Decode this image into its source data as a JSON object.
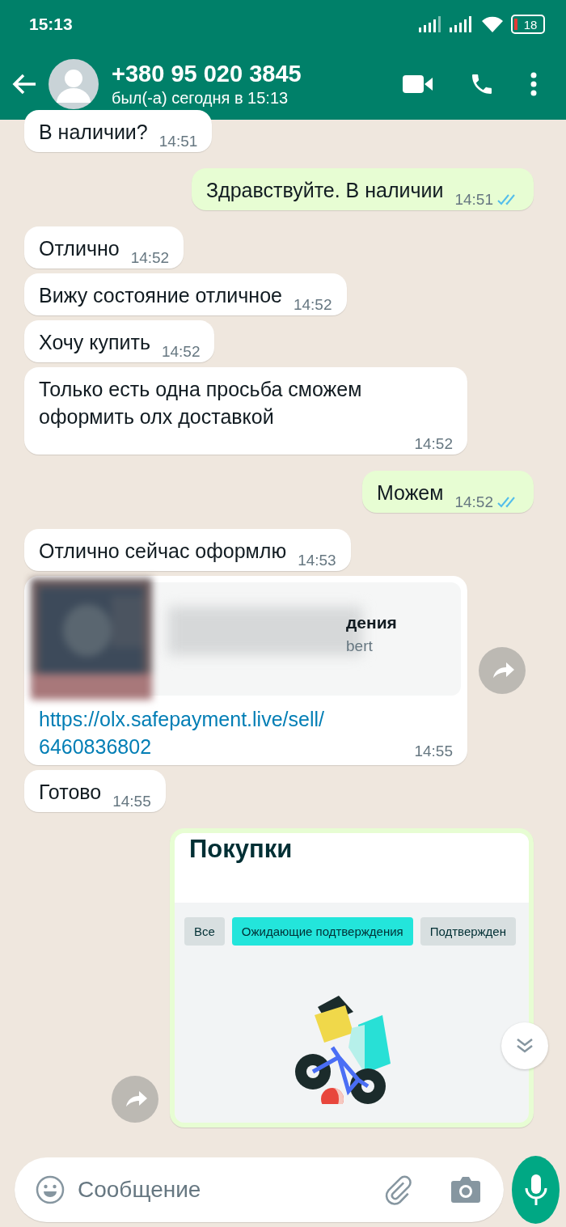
{
  "status_bar": {
    "time": "15:13",
    "battery": "18"
  },
  "header": {
    "title": "+380 95 020 3845",
    "subtitle": "был(-а) сегодня в 15:13"
  },
  "messages": [
    {
      "kind": "text",
      "outgoing": false,
      "text": "В наличии?",
      "time": "14:51"
    },
    {
      "kind": "text",
      "outgoing": true,
      "text": "Здравствуйте. В наличии",
      "time": "14:51",
      "read": true
    },
    {
      "kind": "text",
      "outgoing": false,
      "text": "Отлично",
      "time": "14:52"
    },
    {
      "kind": "text",
      "outgoing": false,
      "text": "Вижу состояние отличное",
      "time": "14:52"
    },
    {
      "kind": "text",
      "outgoing": false,
      "text": "Хочу купить",
      "time": "14:52"
    },
    {
      "kind": "text",
      "outgoing": false,
      "text": "Только есть одна просьба сможем оформить олх доставкой",
      "time": "14:52"
    },
    {
      "kind": "text",
      "outgoing": true,
      "text": "Можем",
      "time": "14:52",
      "read": true
    },
    {
      "kind": "text",
      "outgoing": false,
      "text": "Отлично сейчас оформлю",
      "time": "14:53"
    },
    {
      "kind": "link",
      "outgoing": false,
      "preview_title": "дения",
      "preview_subtitle": "bert",
      "url": "https://olx.safepayment.live/sell/6460836802",
      "time": "14:55"
    },
    {
      "kind": "text",
      "outgoing": false,
      "text": "Готово",
      "time": "14:55"
    },
    {
      "kind": "screenshot",
      "outgoing": true,
      "title": "Покупки",
      "chips": [
        {
          "label": "Все",
          "selected": false
        },
        {
          "label": "Ожидающие подтверждения",
          "selected": true
        },
        {
          "label": "Подтвержден",
          "selected": false
        }
      ]
    }
  ],
  "composer": {
    "placeholder": "Сообщение"
  }
}
